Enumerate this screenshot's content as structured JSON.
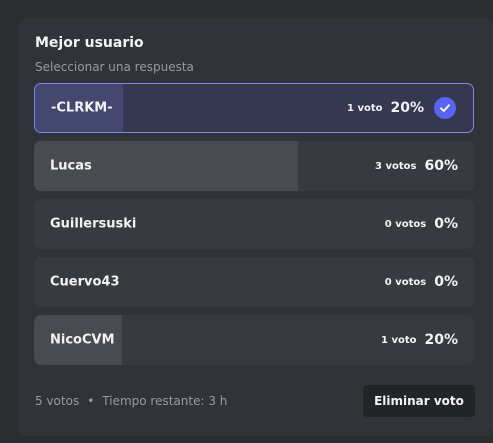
{
  "poll": {
    "question": "Mejor usuario",
    "instruction": "Seleccionar una respuesta",
    "options": [
      {
        "label": "-CLRKM-",
        "votes": "1 voto",
        "percent": "20%",
        "share": 0.2,
        "selected": true
      },
      {
        "label": "Lucas",
        "votes": "3 votos",
        "percent": "60%",
        "share": 0.6,
        "selected": false
      },
      {
        "label": "Guillersuski",
        "votes": "0 votos",
        "percent": "0%",
        "share": 0.0,
        "selected": false
      },
      {
        "label": "Cuervo43",
        "votes": "0 votos",
        "percent": "0%",
        "share": 0.0,
        "selected": false
      },
      {
        "label": "NicoCVM",
        "votes": "1 voto",
        "percent": "20%",
        "share": 0.2,
        "selected": false
      }
    ],
    "footer": {
      "total_votes": "5 votos",
      "separator": "•",
      "time_remaining": "Tiempo restante: 3 h"
    },
    "remove_vote_label": "Eliminar voto"
  },
  "colors": {
    "accent": "#5865f2",
    "selected_border": "#7f86e8"
  },
  "icons": {
    "selected_check": "check-circle-icon"
  }
}
